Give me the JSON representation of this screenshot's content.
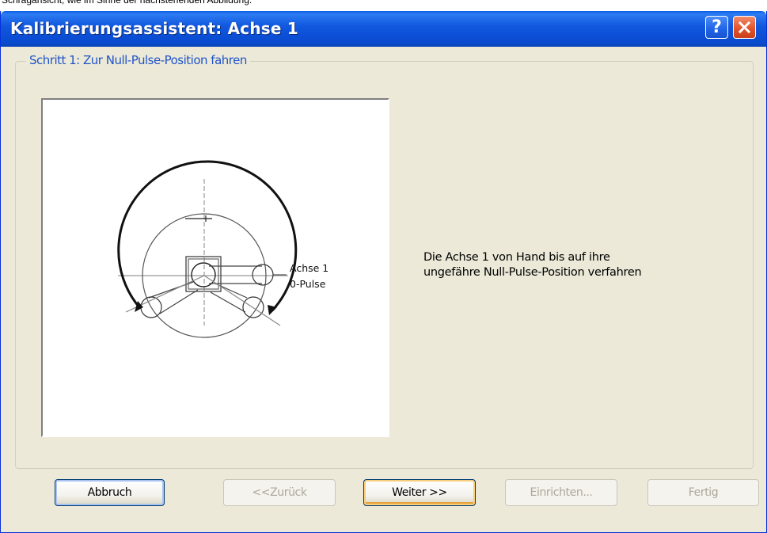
{
  "window": {
    "title": "Kalibrierungsassistent: Achse 1"
  },
  "caption_fragment": "Schrägansicht, wie im Sinne der nachstehenden Abbildung.",
  "step": {
    "title": "Schritt 1: Zur Null-Pulse-Position fahren"
  },
  "illustration": {
    "label_line1": "Achse 1",
    "label_line2": "0-Pulse"
  },
  "description": {
    "line1": "Die Achse 1 von Hand bis auf ihre",
    "line2": "ungefähre Null-Pulse-Position verfahren"
  },
  "buttons": {
    "cancel": "Abbruch",
    "back": "<<Zurück",
    "next": "Weiter >>",
    "setup": "Einrichten...",
    "finish": "Fertig"
  },
  "icons": {
    "help": "help-icon",
    "close": "close-icon"
  },
  "colors": {
    "titlebar": "#0b4fd6",
    "dialog_bg": "#ece9d8",
    "step_title": "#1f54c8"
  }
}
